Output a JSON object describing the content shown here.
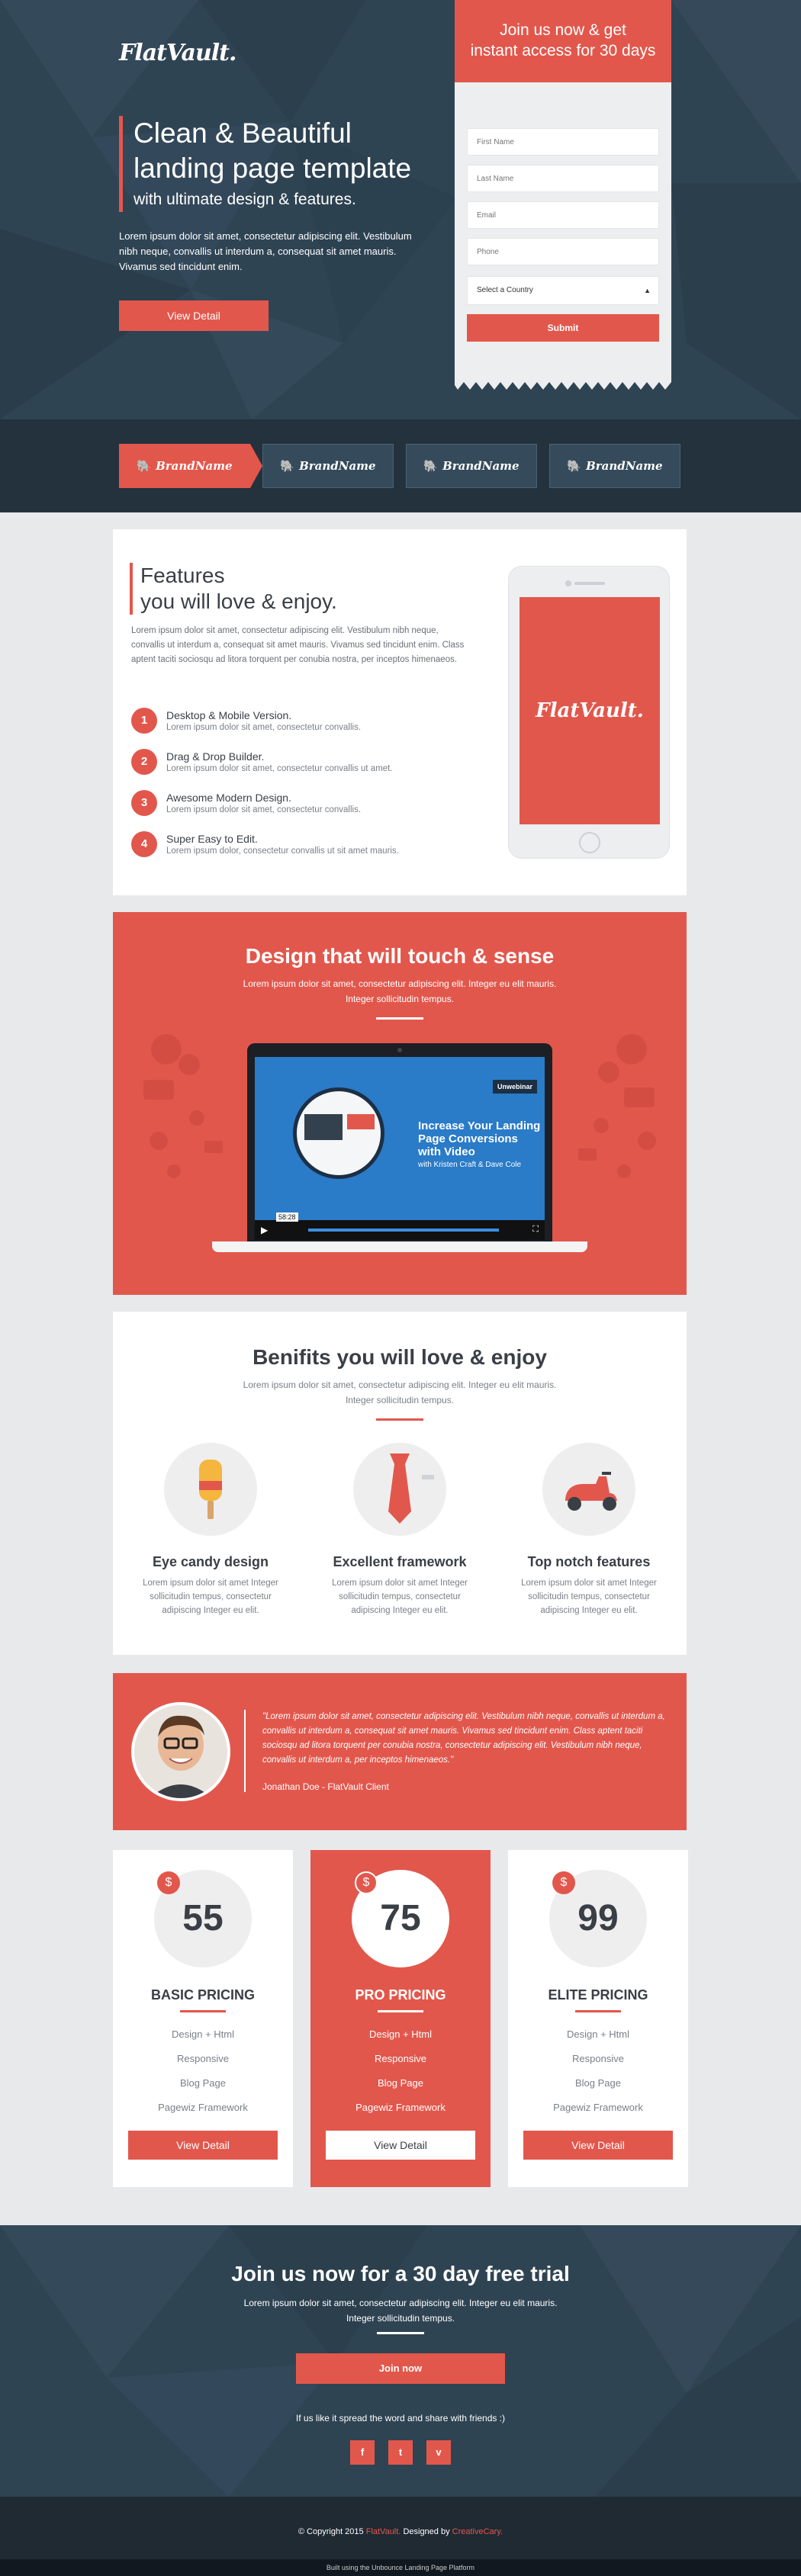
{
  "colors": {
    "accent": "#e2574c",
    "dark": "#2f4453",
    "footer": "#1f2a33",
    "light": "#e8e9eb"
  },
  "hero": {
    "logo": "FlatVault.",
    "title_line1": "Clean & Beautiful",
    "title_line2": "landing page template",
    "subtitle": "with ultimate design & features.",
    "text": "Lorem ipsum dolor sit amet, consectetur adipiscing elit. Vestibulum nibh neque, convallis ut interdum a, consequat sit amet mauris. Vivamus sed tincidunt enim.",
    "button": "View Detail"
  },
  "signup": {
    "title_line1": "Join us now & get",
    "title_line2": "instant access for 30 days",
    "first_name": "First Name",
    "last_name": "Last Name",
    "email": "Email",
    "phone": "Phone",
    "country": "Select a Country",
    "submit": "Submit"
  },
  "brands": [
    "BrandName",
    "BrandName",
    "BrandName",
    "BrandName"
  ],
  "features": {
    "title_line1": "Features",
    "title_line2": "you will love & enjoy.",
    "desc": "Lorem ipsum dolor sit amet, consectetur adipiscing elit. Vestibulum nibh neque, convallis ut interdum a, consequat sit amet mauris. Vivamus sed tincidunt enim. Class aptent taciti sociosqu ad litora torquent per conubia nostra, per inceptos himenaeos.",
    "items": [
      {
        "num": "1",
        "title": "Desktop & Mobile Version.",
        "sub": "Lorem ipsum dolor sit amet, consectetur convallis."
      },
      {
        "num": "2",
        "title": "Drag & Drop Builder.",
        "sub": "Lorem ipsum dolor sit amet, consectetur convallis ut amet."
      },
      {
        "num": "3",
        "title": "Awesome Modern Design.",
        "sub": "Lorem ipsum dolor sit amet, consectetur convallis."
      },
      {
        "num": "4",
        "title": "Super Easy to Edit.",
        "sub": "Lorem ipsum dolor, consectetur convallis ut sit amet mauris."
      }
    ],
    "phone_logo": "FlatVault."
  },
  "video": {
    "title": "Design that will touch & sense",
    "desc_line1": "Lorem ipsum dolor sit amet, consectetur adipiscing elit. Integer eu elit mauris.",
    "desc_line2": "Integer sollicitudin tempus.",
    "player_headline_1": "Increase Your Landing",
    "player_headline_2": "Page Conversions",
    "player_headline_3": "with Video",
    "player_byline": "with Kristen Craft & Dave Cole",
    "player_badge": "Unwebinar",
    "player_time": "58:28"
  },
  "benefits": {
    "title": "Benifits you will love & enjoy",
    "desc_line1": "Lorem ipsum dolor sit amet, consectetur adipiscing elit. Integer eu elit mauris.",
    "desc_line2": "Integer sollicitudin tempus.",
    "items": [
      {
        "title": "Eye candy design",
        "text": "Lorem ipsum dolor sit amet Integer sollicitudin tempus, consectetur adipiscing Integer eu elit."
      },
      {
        "title": "Excellent framework",
        "text": "Lorem ipsum dolor sit amet Integer sollicitudin tempus, consectetur adipiscing Integer eu elit."
      },
      {
        "title": "Top notch features",
        "text": "Lorem ipsum dolor sit amet Integer sollicitudin tempus, consectetur adipiscing Integer eu elit."
      }
    ]
  },
  "testimonial": {
    "quote": "\"Lorem ipsum dolor sit amet, consectetur adipiscing elit. Vestibulum nibh neque, convallis ut interdum a, convallis ut interdum a,  consequat sit amet mauris. Vivamus sed tincidunt enim. Class aptent taciti sociosqu ad litora torquent per conubia nostra,  consectetur adipiscing elit. Vestibulum nibh neque, convallis ut interdum a, per inceptos himenaeos.\"",
    "author": "Jonathan Doe - FlatVault Client"
  },
  "pricing": [
    {
      "price": "55",
      "currency": "$",
      "title": "BASIC PRICING",
      "features": [
        "Design + Html",
        "Responsive",
        "Blog Page",
        "Pagewiz Framework"
      ],
      "button": "View Detail"
    },
    {
      "price": "75",
      "currency": "$",
      "title": "PRO PRICING",
      "features": [
        "Design + Html",
        "Responsive",
        "Blog Page",
        "Pagewiz Framework"
      ],
      "button": "View Detail"
    },
    {
      "price": "99",
      "currency": "$",
      "title": "ELITE PRICING",
      "features": [
        "Design + Html",
        "Responsive",
        "Blog Page",
        "Pagewiz Framework"
      ],
      "button": "View Detail"
    }
  ],
  "cta": {
    "title": "Join us now for a 30 day free trial",
    "desc_line1": "Lorem ipsum dolor sit amet, consectetur adipiscing elit. Integer eu elit mauris.",
    "desc_line2": "Integer sollicitudin tempus.",
    "button": "Join now",
    "share": "If us like it spread the word and share with friends :)",
    "social": [
      "f",
      "t",
      "v"
    ]
  },
  "footer": {
    "copy_prefix": "© Copyright 2015",
    "brand": "FlatVault.",
    "designed_by": "Designed by",
    "designer": "CreativeCary.",
    "built": "Built using the Unbounce Landing Page Platform"
  }
}
